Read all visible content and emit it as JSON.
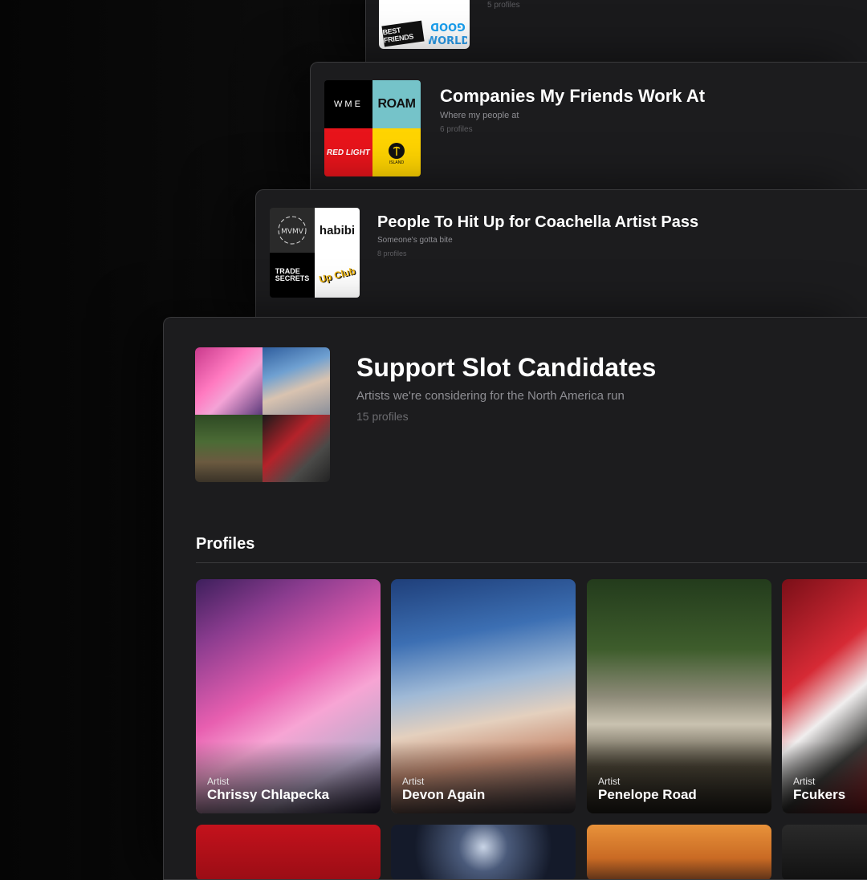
{
  "lists": [
    {
      "title": "",
      "description": "",
      "count": "5 profiles",
      "logos": [
        "BEST FRIENDS",
        "GOOD WORLD"
      ]
    },
    {
      "title": "Companies My Friends Work At",
      "description": "Where my people at",
      "count": "6 profiles",
      "logos": [
        "WME",
        "ROAM",
        "RED LIGHT",
        "ISLAND"
      ]
    },
    {
      "title": "People To Hit Up for Coachella Artist Pass",
      "description": "Someone's gotta bite",
      "count": "8 profiles",
      "logos": [
        "MVMVMVMV",
        "habibi",
        "TRADE SECRETS",
        "Up Club"
      ]
    }
  ],
  "main_list": {
    "title": "Support Slot Candidates",
    "description": "Artists we're considering for the North America run",
    "count": "15 profiles"
  },
  "profiles_section": {
    "heading": "Profiles",
    "items": [
      {
        "category": "Artist",
        "name": "Chrissy Chlapecka"
      },
      {
        "category": "Artist",
        "name": "Devon Again"
      },
      {
        "category": "Artist",
        "name": "Penelope Road"
      },
      {
        "category": "Artist",
        "name": "Fcukers"
      }
    ]
  }
}
